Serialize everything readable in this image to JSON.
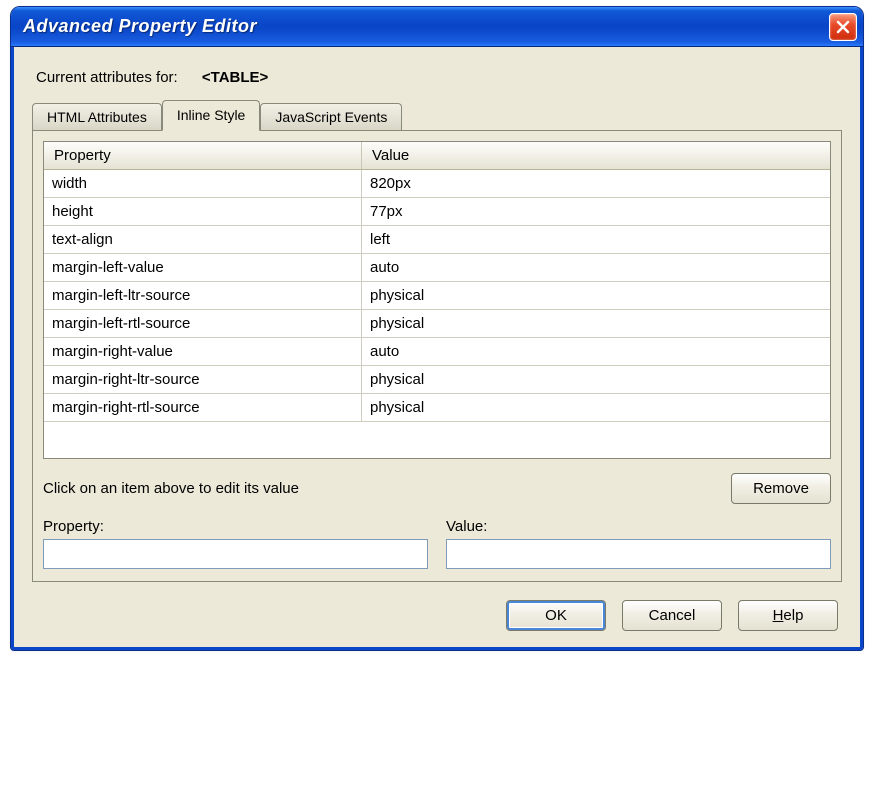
{
  "window": {
    "title": "Advanced Property Editor"
  },
  "header": {
    "label": "Current attributes for:",
    "tag": "<TABLE>"
  },
  "tabs": [
    {
      "label": "HTML Attributes",
      "active": false
    },
    {
      "label": "Inline Style",
      "active": true
    },
    {
      "label": "JavaScript Events",
      "active": false
    }
  ],
  "grid": {
    "columns": {
      "property": "Property",
      "value": "Value"
    },
    "rows": [
      {
        "property": "width",
        "value": "820px"
      },
      {
        "property": "height",
        "value": "77px"
      },
      {
        "property": "text-align",
        "value": "left"
      },
      {
        "property": "margin-left-value",
        "value": "auto"
      },
      {
        "property": "margin-left-ltr-source",
        "value": "physical"
      },
      {
        "property": "margin-left-rtl-source",
        "value": "physical"
      },
      {
        "property": "margin-right-value",
        "value": "auto"
      },
      {
        "property": "margin-right-ltr-source",
        "value": "physical"
      },
      {
        "property": "margin-right-rtl-source",
        "value": "physical"
      }
    ]
  },
  "hint": "Click on an item above to edit its value",
  "buttons": {
    "remove": "Remove",
    "ok": "OK",
    "cancel": "Cancel",
    "help": "Help"
  },
  "fields": {
    "property_label": "Property:",
    "property_value": "",
    "value_label": "Value:",
    "value_value": ""
  }
}
